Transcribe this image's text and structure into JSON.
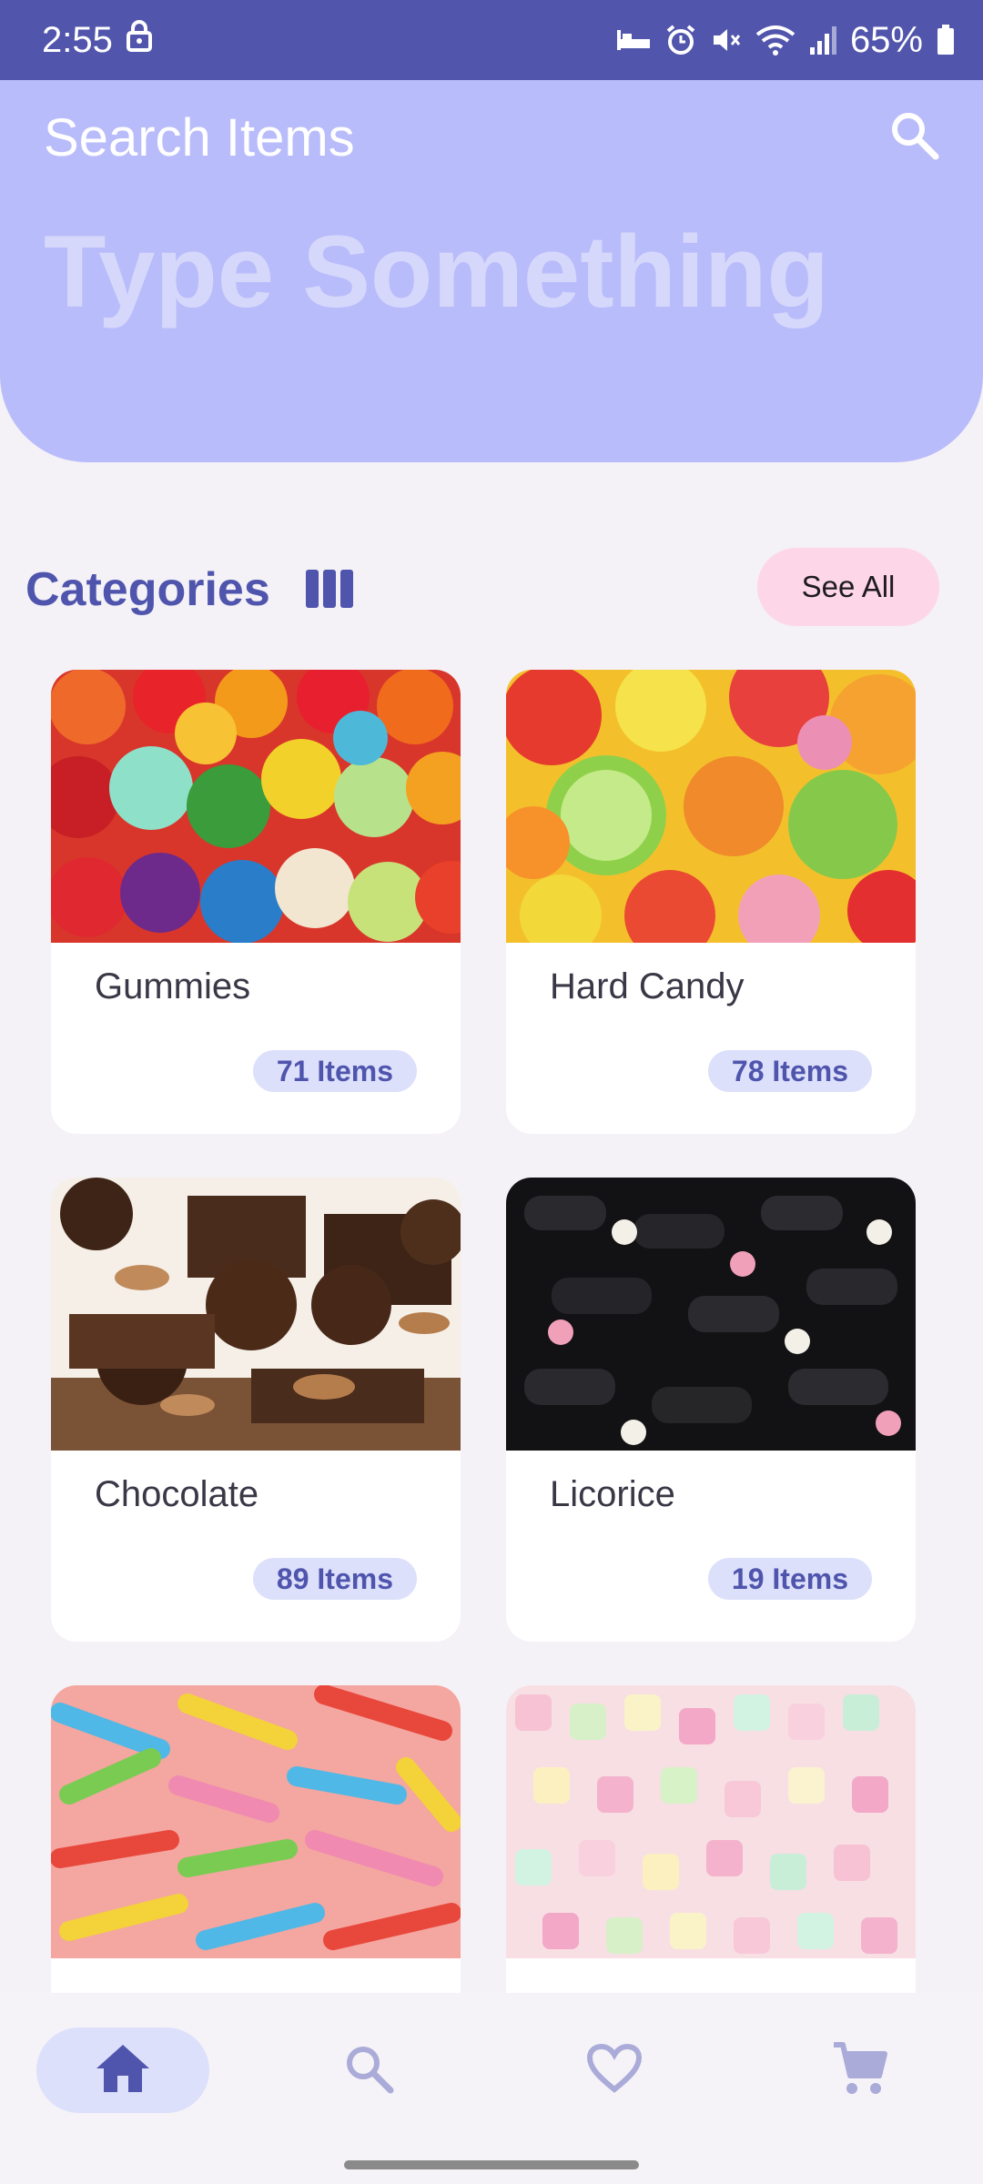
{
  "status_bar": {
    "time": "2:55",
    "battery": "65%",
    "icons": [
      "lock-icon",
      "sleep-icon",
      "alarm-icon",
      "mute-icon",
      "wifi-icon",
      "signal-icon",
      "battery-icon"
    ]
  },
  "header": {
    "title": "Search Items",
    "search_placeholder": "Type Something",
    "search_icon": "search-icon"
  },
  "categories": {
    "title": "Categories",
    "view_toggle_icon": "column-view-icon",
    "see_all_label": "See All",
    "items": [
      {
        "name": "Gummies",
        "count": "71 Items",
        "image": "gummy-bears"
      },
      {
        "name": "Hard Candy",
        "count": "78 Items",
        "image": "lollipops"
      },
      {
        "name": "Chocolate",
        "count": "89 Items",
        "image": "chocolates"
      },
      {
        "name": "Licorice",
        "count": "19 Items",
        "image": "licorice"
      },
      {
        "name": "",
        "count": "",
        "image": "sour-worms"
      },
      {
        "name": "",
        "count": "",
        "image": "marshmallows"
      }
    ]
  },
  "bottom_nav": {
    "items": [
      {
        "icon": "home-icon",
        "active": true
      },
      {
        "icon": "search-icon",
        "active": false
      },
      {
        "icon": "heart-icon",
        "active": false
      },
      {
        "icon": "cart-icon",
        "active": false
      }
    ]
  },
  "colors": {
    "status_bar": "#5155ac",
    "header": "#b9bcfa",
    "accent": "#4f55ad",
    "badge_bg": "#dde0fb",
    "see_all_bg": "#fdd6e7"
  }
}
